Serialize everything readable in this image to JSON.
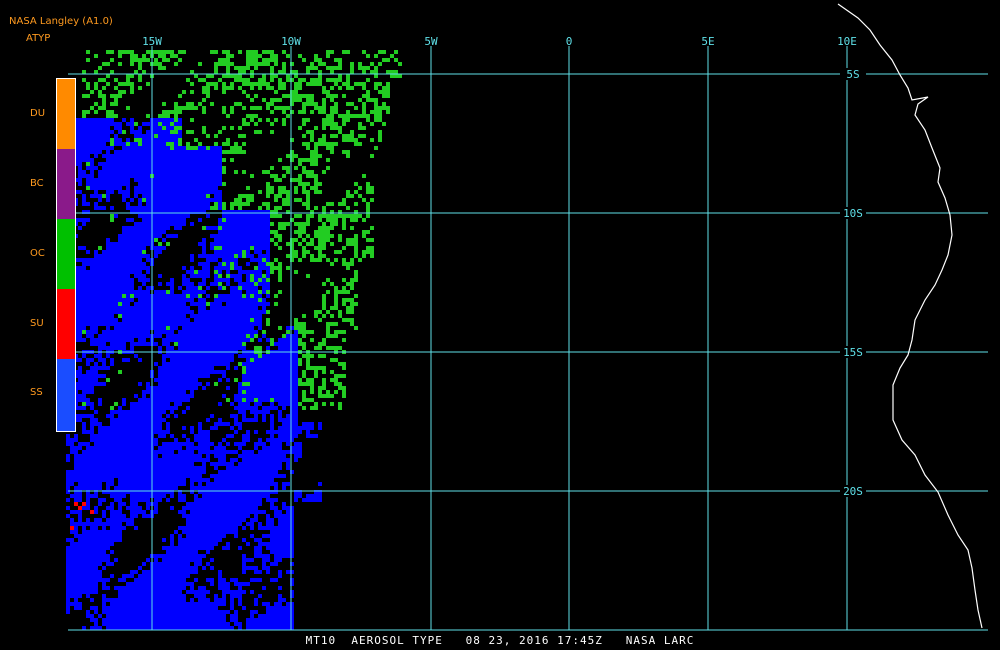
{
  "header": {
    "source": "NASA Langley (A1.0)",
    "product": "ATYP"
  },
  "legend": {
    "items": [
      {
        "code": "DU",
        "color": "#ff8a00"
      },
      {
        "code": "BC",
        "color": "#8a1a8a"
      },
      {
        "code": "OC",
        "color": "#00c000"
      },
      {
        "code": "SU",
        "color": "#ff0000"
      },
      {
        "code": "SS",
        "color": "#1a4dff"
      }
    ]
  },
  "map": {
    "grid_color": "#5fe0e8",
    "coast_color": "#ffffff",
    "lon_labels": [
      "15W",
      "10W",
      "5W",
      "0",
      "5E",
      "10E"
    ],
    "lat_labels": [
      "5S",
      "10S",
      "15S",
      "20S"
    ],
    "colors": {
      "dust": "#ff8a00",
      "bc": "#8a1a8a",
      "oc": "#22cc22",
      "su": "#ff0000",
      "ss": "#0000ff"
    }
  },
  "footer": {
    "text": "MT10  AEROSOL TYPE   08 23, 2016 17:45Z   NASA LARC"
  }
}
